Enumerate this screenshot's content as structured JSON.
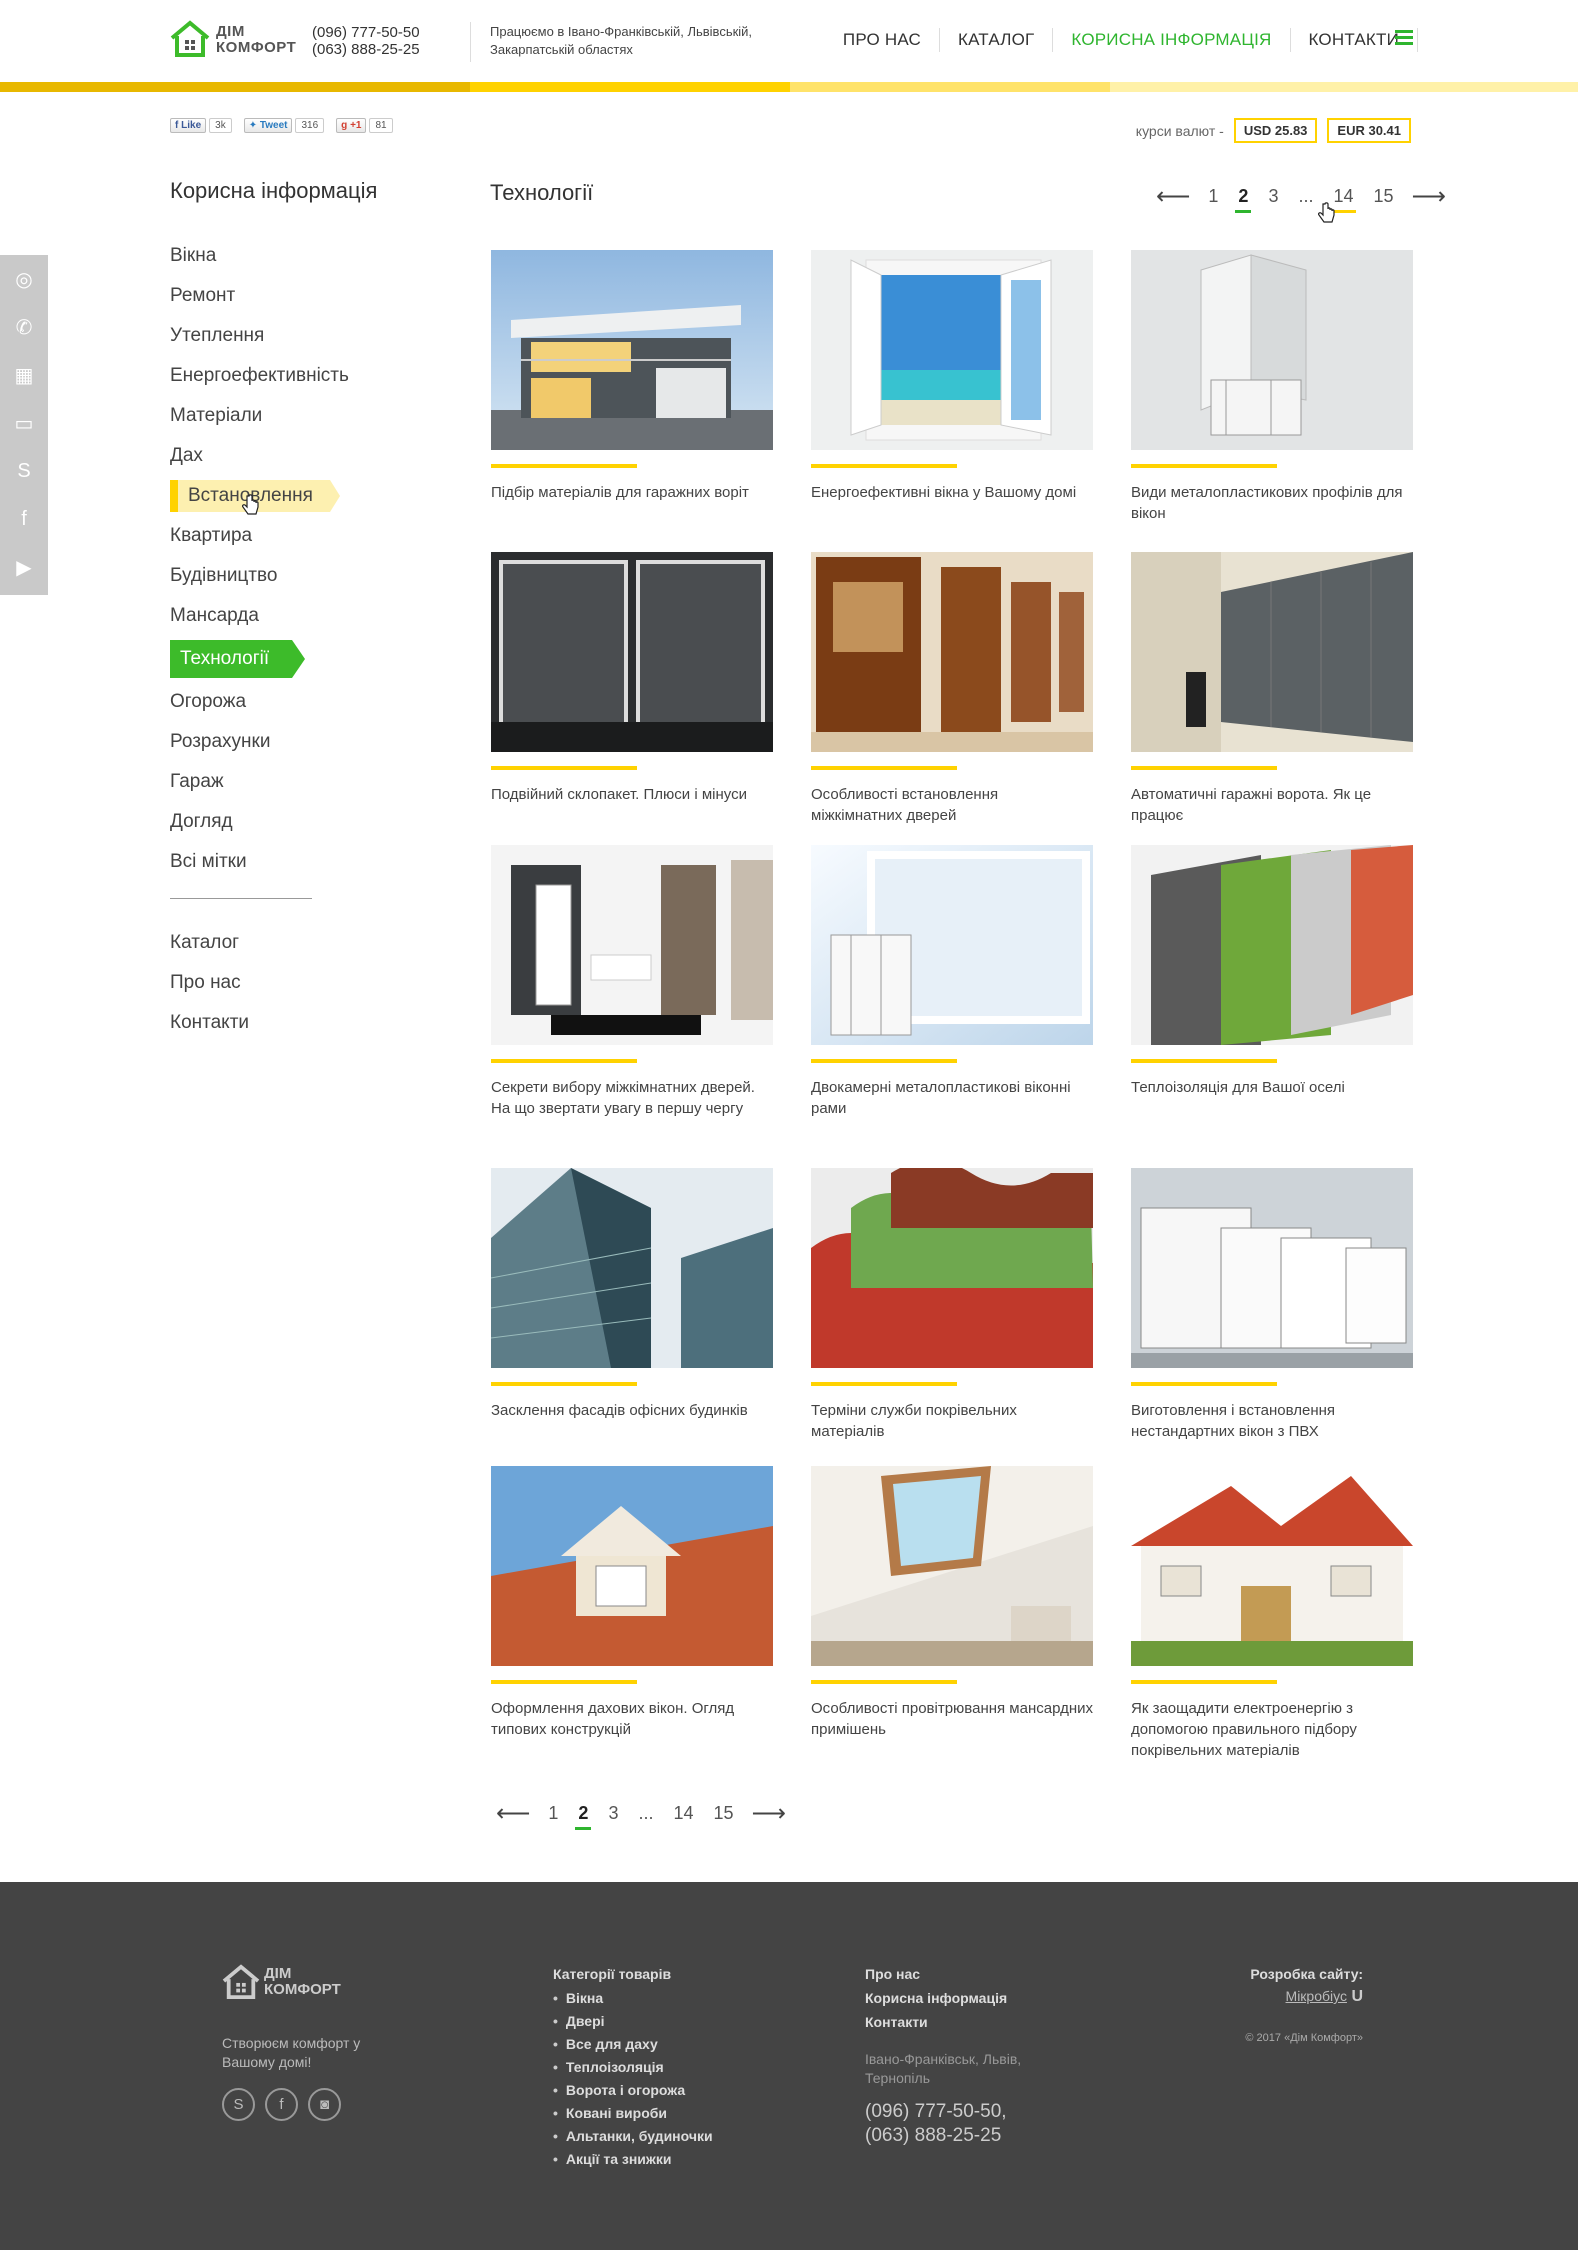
{
  "header": {
    "logo_line1": "Дім",
    "logo_line2": "Комфорт",
    "phone1": "(096) 777-50-50",
    "phone2": "(063) 888-25-25",
    "region": "Працюємо в Івано-Франківській, Львівській, Закарпатській областях",
    "nav": [
      {
        "label": "Про нас"
      },
      {
        "label": "Каталог"
      },
      {
        "label": "Корисна інформація"
      },
      {
        "label": "Контакти"
      }
    ],
    "accent": "#2fb52f",
    "stripe_colors": [
      "#e8b800",
      "#ffd200",
      "#ffe36a",
      "#fff1a8"
    ]
  },
  "social": {
    "fb_label": "Like",
    "fb_count": "3k",
    "tw_label": "Tweet",
    "tw_count": "316",
    "gp_label": "+1",
    "gp_count": "81"
  },
  "rates": {
    "label": "курси валют -",
    "usd": "USD 25.83",
    "eur": "EUR 30.41"
  },
  "sidebar": {
    "title": "Корисна інформація",
    "items": [
      {
        "label": "Вікна"
      },
      {
        "label": "Ремонт"
      },
      {
        "label": "Утеплення"
      },
      {
        "label": "Енергоефективність"
      },
      {
        "label": "Матеріали"
      },
      {
        "label": "Дах"
      },
      {
        "label": "Встановлення"
      },
      {
        "label": "Квартира"
      },
      {
        "label": "Будівництво"
      },
      {
        "label": "Мансарда"
      },
      {
        "label": "Технології"
      },
      {
        "label": "Огорожа"
      },
      {
        "label": "Розрахунки"
      },
      {
        "label": "Гараж"
      },
      {
        "label": "Догляд"
      },
      {
        "label": "Всі мітки"
      }
    ],
    "links": [
      {
        "label": "Каталог"
      },
      {
        "label": "Про нас"
      },
      {
        "label": "Контакти"
      }
    ]
  },
  "main": {
    "title": "Технології",
    "pagination": [
      "1",
      "2",
      "3",
      "...",
      "14",
      "15"
    ],
    "current_page": "2",
    "cards": [
      {
        "caption": "Підбір матеріалів для гаражних воріт",
        "image": "modern-house"
      },
      {
        "caption": "Енергоефективні вікна у Вашому домі",
        "image": "open-window-sea"
      },
      {
        "caption": "Види металопластикових профілів для вікон",
        "image": "window-profile"
      },
      {
        "caption": "Подвійний склопакет. Плюси і мінуси",
        "image": "dark-windows"
      },
      {
        "caption": "Особливості встановлення міжкімнатних дверей",
        "image": "wooden-doors"
      },
      {
        "caption": "Автоматичні гаражні ворота. Як це працює",
        "image": "garage-door"
      },
      {
        "caption": "Секрети вибору міжкімнатних дверей. На що звертати увагу в першу чергу",
        "image": "white-interior"
      },
      {
        "caption": "Двокамерні металопластикові віконні рами",
        "image": "pvc-frame"
      },
      {
        "caption": "Теплоізоляція для Вашої оселі",
        "image": "wall-insulation"
      },
      {
        "caption": "Засклення фасадів офісних будинків",
        "image": "glass-building"
      },
      {
        "caption": "Терміни служби покрівельних матеріалів",
        "image": "roof-sheets"
      },
      {
        "caption": "Виготовлення і встановлення нестандартних вікон з ПВХ",
        "image": "pvc-windows-stack"
      },
      {
        "caption": "Оформлення дахових вікон. Огляд типових конструкцій",
        "image": "dormer-window"
      },
      {
        "caption": "Особливості провітрювання мансардних примішень",
        "image": "attic-room"
      },
      {
        "caption": "Як заощадити електроенергію з допомогою правильного підбору покрівельних матеріалів",
        "image": "red-roof-house"
      }
    ]
  },
  "footer": {
    "tagline": "Створюєм комфорт у Вашому домі!",
    "categories_title": "Категорії товарів",
    "categories": [
      "Вікна",
      "Двері",
      "Все для даху",
      "Теплоізоляція",
      "Ворота і огорожа",
      "Ковані вироби",
      "Альтанки, будиночки",
      "Акції та знижки"
    ],
    "links": [
      "Про нас",
      "Корисна інформація",
      "Контакти"
    ],
    "address": "Івано-Франківськ, Львів, Тернопіль",
    "phone1": "(096) 777-50-50,",
    "phone2": "(063) 888-25-25",
    "dev_label": "Розробка сайту:",
    "dev_name": "Мікробіус",
    "copyright": "© 2017 «Дім Комфорт»"
  }
}
